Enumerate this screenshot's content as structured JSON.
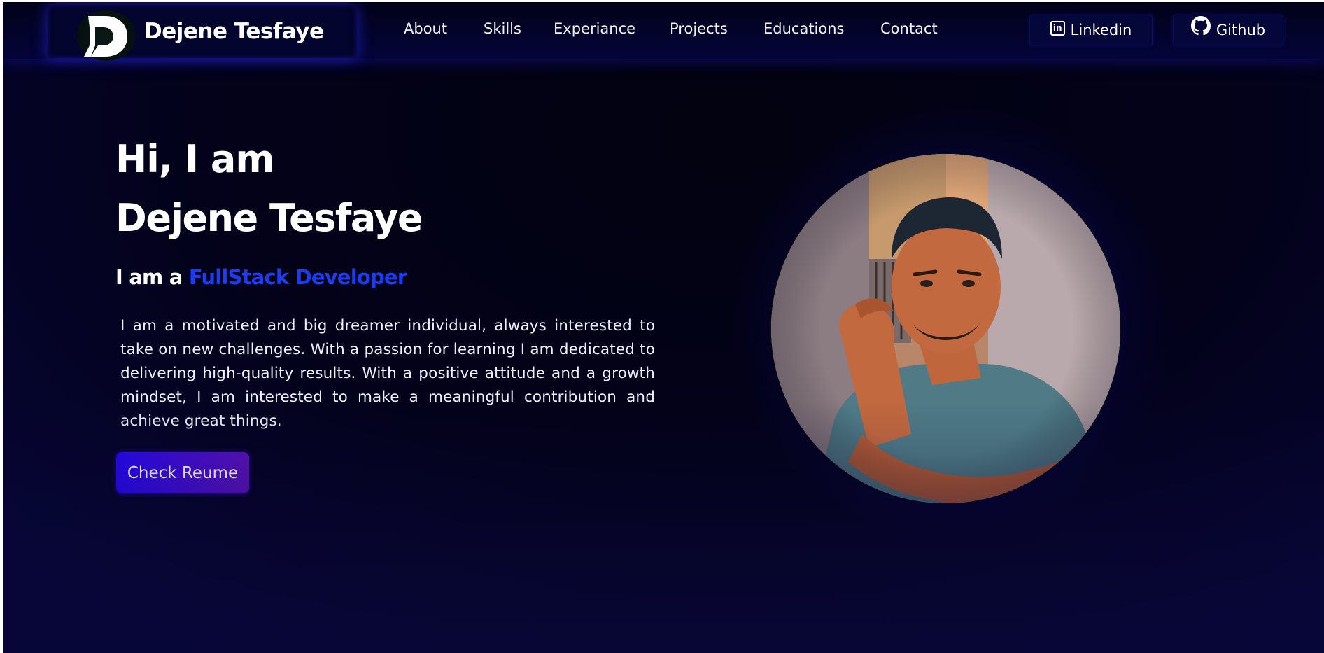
{
  "brand": {
    "logo_letter": "D",
    "name": "Dejene Tesfaye",
    "accent_color": "#1c3cf0"
  },
  "nav": {
    "links": [
      "About",
      "Skills",
      "Experiance",
      "Projects",
      "Educations",
      "Contact"
    ]
  },
  "social": {
    "linkedin": {
      "label": "Linkedin",
      "icon": "linkedin-icon"
    },
    "github": {
      "label": "Github",
      "icon": "github-icon"
    }
  },
  "hero": {
    "greeting": "Hi, I am",
    "name": "Dejene Tesfaye",
    "role_prefix": "I am a",
    "role": "FullStack Developer",
    "bio": "I am a motivated and big dreamer individual, always interested to take on new challenges. With a passion for learning I am dedicated to delivering high-quality results. With a positive attitude and a growth mindset, I am interested to make a meaningful contribution and achieve great things.",
    "resume_button": "Check Reume"
  },
  "colors": {
    "background": "#03021a",
    "button_start": "#2708f0",
    "button_end": "#5a12b8",
    "glow": "#1414c8"
  }
}
